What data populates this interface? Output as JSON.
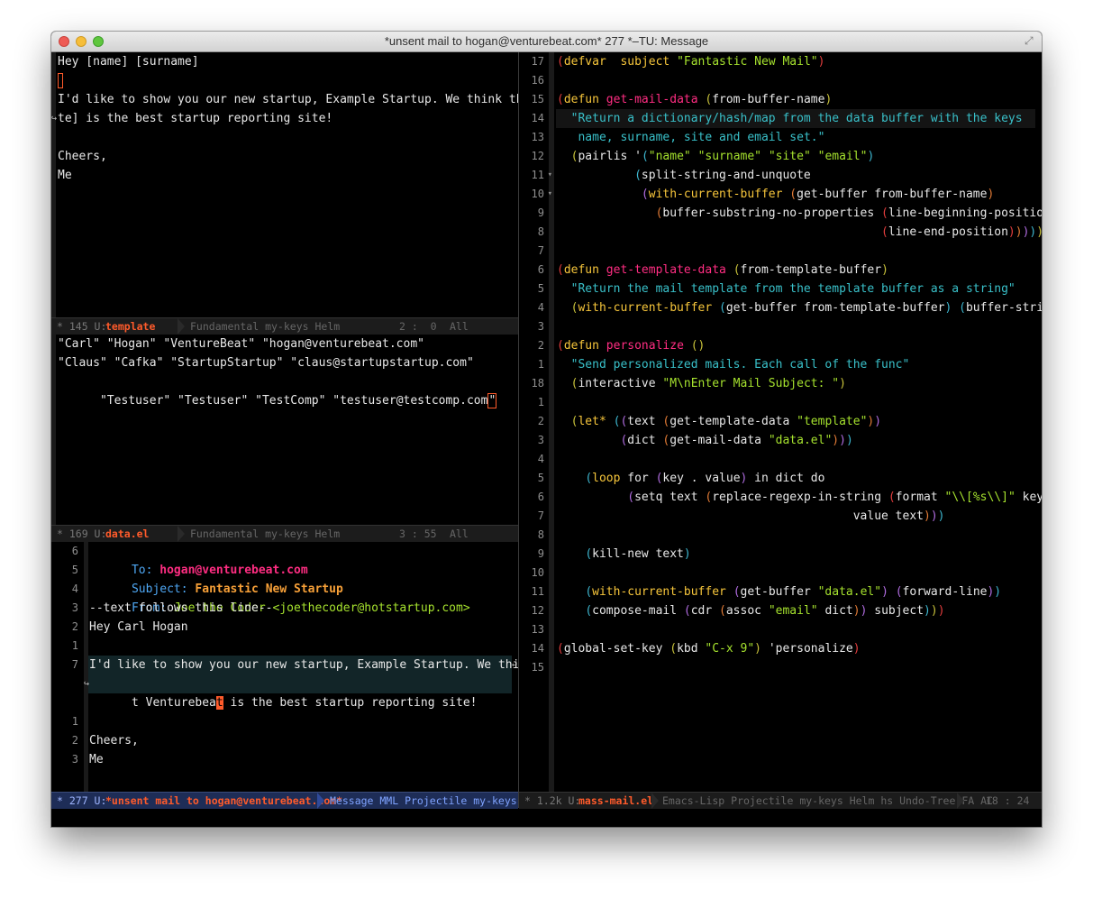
{
  "window": {
    "title": "*unsent mail to hogan@venturebeat.com* 277 *–TU: Message"
  },
  "template_buffer": {
    "lines": [
      "Hey [name] [surname]",
      "",
      "I'd like to show you our new startup, Example Startup. We think that [si",
      "te] is the best startup reporting site!",
      "",
      "Cheers,",
      "Me"
    ],
    "modeline": {
      "prefix": "* 145 U:",
      "buffer": "template",
      "modes": "Fundamental my-keys Helm",
      "position": "2 :  0",
      "scroll": "All"
    }
  },
  "data_buffer": {
    "lines": [
      "\"Carl\" \"Hogan\" \"VentureBeat\" \"hogan@venturebeat.com\"",
      "\"Claus\" \"Cafka\" \"StartupStartup\" \"claus@startupstartup.com\"",
      "\"Testuser\" \"Testuser\" \"TestComp\" \"testuser@testcomp.com"
    ],
    "last_char": "\"",
    "modeline": {
      "prefix": "* 169 U:",
      "buffer": "data.el",
      "modes": "Fundamental my-keys Helm",
      "position": "3 : 55",
      "scroll": "All"
    }
  },
  "message_buffer": {
    "line_numbers": [
      "6",
      "5",
      "4",
      "3",
      "2",
      "1",
      "7",
      "",
      "1",
      "2",
      "3"
    ],
    "to_key": "To:",
    "to_value": "hogan@venturebeat.com",
    "subject_key": "Subject:",
    "subject_value": "Fantastic New Startup",
    "from_key": "From:",
    "from_value": "Joe the Coder <joethecoder@hotstartup.com>",
    "separator": "--text follows this line--",
    "greeting": "Hey Carl Hogan",
    "body_line1": "I'd like to show you our new startup, Example Startup. We think tha",
    "body_line2_before": "t Venturebea",
    "body_line2_cursor": "t",
    "body_line2_after": " is the best startup reporting site!",
    "cheers": "Cheers,",
    "sign": "Me",
    "modeline": {
      "prefix": "* 277 U:",
      "buffer": "*unsent mail to hogan@venturebeat.com*",
      "modes": "Message MML Projectile my-keys Helm"
    }
  },
  "code_buffer": {
    "line_numbers": [
      "17",
      "16",
      "15",
      "14",
      "13",
      "12",
      "11",
      "10",
      "9",
      "8",
      "7",
      "6",
      "5",
      "4",
      "3",
      "2",
      "1",
      "18",
      "1",
      "2",
      "3",
      "4",
      "5",
      "6",
      "7",
      "8",
      "9",
      "10",
      "11",
      "12",
      "13",
      "14",
      "15"
    ],
    "fold_markers": [
      "",
      "",
      "",
      "",
      "",
      "",
      "▾",
      "▾",
      "",
      "",
      "",
      "",
      "",
      "",
      "",
      "",
      "",
      "",
      "",
      "",
      "",
      "",
      "",
      "",
      "",
      "",
      "",
      "",
      "",
      "",
      "",
      "",
      ""
    ],
    "lines": [
      [
        [
          "p1",
          "("
        ],
        [
          "kw",
          "defvar"
        ],
        [
          "",
          "  "
        ],
        [
          "var",
          "subject"
        ],
        [
          "",
          " "
        ],
        [
          "str",
          "\"Fantastic New Mail\""
        ],
        [
          "p1",
          ")"
        ]
      ],
      [],
      [
        [
          "p1",
          "("
        ],
        [
          "kw",
          "defun"
        ],
        [
          "",
          " "
        ],
        [
          "fn",
          "get-mail-data"
        ],
        [
          "",
          " "
        ],
        [
          "p2",
          "("
        ],
        [
          "",
          "from-buffer-name"
        ],
        [
          "p2",
          ")"
        ]
      ],
      [
        [
          "",
          "  "
        ],
        [
          "doc",
          "\"Return a dictionary/hash/map from the data buffer with the keys"
        ]
      ],
      [
        [
          "",
          "   "
        ],
        [
          "doc",
          "name, surname, site and email set.\""
        ]
      ],
      [
        [
          "",
          "  "
        ],
        [
          "p2",
          "("
        ],
        [
          "",
          "pairlis '"
        ],
        [
          "p3",
          "("
        ],
        [
          "str",
          "\"name\""
        ],
        [
          "",
          " "
        ],
        [
          "str",
          "\"surname\""
        ],
        [
          "",
          " "
        ],
        [
          "str",
          "\"site\""
        ],
        [
          "",
          " "
        ],
        [
          "str",
          "\"email\""
        ],
        [
          "p3",
          ")"
        ]
      ],
      [
        [
          "",
          "           "
        ],
        [
          "p3",
          "("
        ],
        [
          "",
          "split-string-and-unquote"
        ]
      ],
      [
        [
          "",
          "            "
        ],
        [
          "p4",
          "("
        ],
        [
          "kw",
          "with-current-buffer"
        ],
        [
          "",
          " "
        ],
        [
          "p5",
          "("
        ],
        [
          "",
          "get-buffer from-buffer-name"
        ],
        [
          "p5",
          ")"
        ]
      ],
      [
        [
          "",
          "              "
        ],
        [
          "p5",
          "("
        ],
        [
          "",
          "buffer-substring-no-properties "
        ],
        [
          "p1",
          "("
        ],
        [
          "",
          "line-beginning-position"
        ],
        [
          "p1",
          ")"
        ]
      ],
      [
        [
          "",
          "                                              "
        ],
        [
          "p1",
          "("
        ],
        [
          "",
          "line-end-position"
        ],
        [
          "p1",
          ")"
        ],
        [
          "p5",
          ")"
        ],
        [
          "p4",
          ")"
        ],
        [
          "p3",
          ")"
        ],
        [
          "p2",
          ")"
        ],
        [
          "p1",
          ")"
        ]
      ],
      [],
      [
        [
          "p1",
          "("
        ],
        [
          "kw",
          "defun"
        ],
        [
          "",
          " "
        ],
        [
          "fn",
          "get-template-data"
        ],
        [
          "",
          " "
        ],
        [
          "p2",
          "("
        ],
        [
          "",
          "from-template-buffer"
        ],
        [
          "p2",
          ")"
        ]
      ],
      [
        [
          "",
          "  "
        ],
        [
          "doc",
          "\"Return the mail template from the template buffer as a string\""
        ]
      ],
      [
        [
          "",
          "  "
        ],
        [
          "p2",
          "("
        ],
        [
          "kw",
          "with-current-buffer"
        ],
        [
          "",
          " "
        ],
        [
          "p3",
          "("
        ],
        [
          "",
          "get-buffer from-template-buffer"
        ],
        [
          "p3",
          ")"
        ],
        [
          "",
          " "
        ],
        [
          "p3",
          "("
        ],
        [
          "",
          "buffer-string"
        ],
        [
          "p3",
          ")"
        ],
        [
          "p2",
          ")"
        ],
        [
          "p1",
          ")"
        ]
      ],
      [],
      [
        [
          "p1",
          "("
        ],
        [
          "kw",
          "defun"
        ],
        [
          "",
          " "
        ],
        [
          "fn",
          "personalize"
        ],
        [
          "",
          " "
        ],
        [
          "p2",
          "()"
        ]
      ],
      [
        [
          "",
          "  "
        ],
        [
          "doc",
          "\"Send personalized mails. Each call of the func\""
        ]
      ],
      [
        [
          "",
          "  "
        ],
        [
          "p2",
          "("
        ],
        [
          "",
          "interactive "
        ],
        [
          "str",
          "\"M\\nEnter Mail Subject: \""
        ],
        [
          "p2",
          ")"
        ]
      ],
      [],
      [
        [
          "",
          "  "
        ],
        [
          "p2",
          "("
        ],
        [
          "kw",
          "let*"
        ],
        [
          "",
          " "
        ],
        [
          "p3",
          "("
        ],
        [
          "p4",
          "("
        ],
        [
          "",
          "text "
        ],
        [
          "p5",
          "("
        ],
        [
          "",
          "get-template-data "
        ],
        [
          "str",
          "\"template\""
        ],
        [
          "p5",
          ")"
        ],
        [
          "p4",
          ")"
        ]
      ],
      [
        [
          "",
          "         "
        ],
        [
          "p4",
          "("
        ],
        [
          "",
          "dict "
        ],
        [
          "p5",
          "("
        ],
        [
          "",
          "get-mail-data "
        ],
        [
          "str",
          "\"data.el\""
        ],
        [
          "p5",
          ")"
        ],
        [
          "p4",
          ")"
        ],
        [
          "p3",
          ")"
        ]
      ],
      [],
      [
        [
          "",
          "    "
        ],
        [
          "p3",
          "("
        ],
        [
          "kw",
          "loop"
        ],
        [
          "",
          " for "
        ],
        [
          "p4",
          "("
        ],
        [
          "",
          "key . value"
        ],
        [
          "p4",
          ")"
        ],
        [
          "",
          " in dict do"
        ]
      ],
      [
        [
          "",
          "          "
        ],
        [
          "p4",
          "("
        ],
        [
          "",
          "setq text "
        ],
        [
          "p5",
          "("
        ],
        [
          "",
          "replace-regexp-in-string "
        ],
        [
          "p1",
          "("
        ],
        [
          "",
          "format "
        ],
        [
          "str",
          "\"\\\\[%s\\\\]\""
        ],
        [
          "",
          " key"
        ],
        [
          "p1",
          ")"
        ]
      ],
      [
        [
          "",
          "                                          value text"
        ],
        [
          "p5",
          ")"
        ],
        [
          "p4",
          ")"
        ],
        [
          "p3",
          ")"
        ]
      ],
      [],
      [
        [
          "",
          "    "
        ],
        [
          "p3",
          "("
        ],
        [
          "",
          "kill-new text"
        ],
        [
          "p3",
          ")"
        ]
      ],
      [],
      [
        [
          "",
          "    "
        ],
        [
          "p3",
          "("
        ],
        [
          "kw",
          "with-current-buffer"
        ],
        [
          "",
          " "
        ],
        [
          "p4",
          "("
        ],
        [
          "",
          "get-buffer "
        ],
        [
          "str",
          "\"data.el\""
        ],
        [
          "p4",
          ")"
        ],
        [
          "",
          " "
        ],
        [
          "p4",
          "("
        ],
        [
          "",
          "forward-line"
        ],
        [
          "p4",
          ")"
        ],
        [
          "p3",
          ")"
        ]
      ],
      [
        [
          "",
          "    "
        ],
        [
          "p3",
          "("
        ],
        [
          "",
          "compose-mail "
        ],
        [
          "p4",
          "("
        ],
        [
          "",
          "cdr "
        ],
        [
          "p5",
          "("
        ],
        [
          "",
          "assoc "
        ],
        [
          "str",
          "\"email\""
        ],
        [
          "",
          " dict"
        ],
        [
          "p5",
          ")"
        ],
        [
          "p4",
          ")"
        ],
        [
          "",
          " subject"
        ],
        [
          "p3",
          ")"
        ],
        [
          "p2",
          ")"
        ],
        [
          "p1",
          ")"
        ]
      ],
      [],
      [
        [
          "p1",
          "("
        ],
        [
          "",
          "global-set-key "
        ],
        [
          "p2",
          "("
        ],
        [
          "",
          "kbd "
        ],
        [
          "str",
          "\"C-x 9\""
        ],
        [
          "p2",
          ")"
        ],
        [
          "",
          " 'personalize"
        ],
        [
          "p1",
          ")"
        ]
      ],
      []
    ],
    "modeline": {
      "prefix": "* 1.2k U:",
      "buffer": "mass-mail.el",
      "modes": "Emacs-Lisp Projectile my-keys Helm hs Undo-Tree FA AC",
      "position": "18 : 24"
    }
  },
  "colors": {
    "accent": "#ff5b2b",
    "keyword": "#f7c63b",
    "function": "#ff2d82",
    "string": "#a6e22e",
    "docstring": "#39c0c9",
    "modeline_active": "#2a3a6a"
  }
}
